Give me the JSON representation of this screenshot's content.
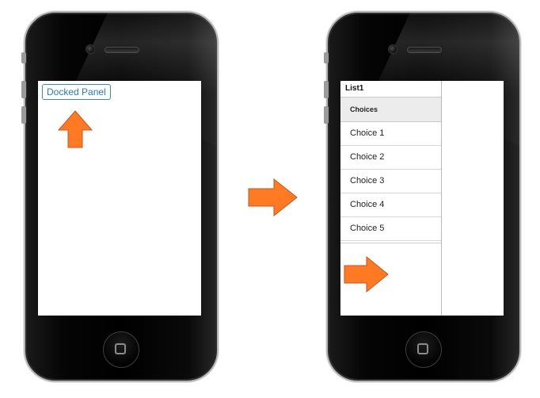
{
  "left_screen": {
    "docked_button_label": "Docked Panel"
  },
  "right_screen": {
    "panel_title": "List1",
    "list_header": "Choices",
    "items": [
      {
        "label": "Choice 1"
      },
      {
        "label": "Choice 2"
      },
      {
        "label": "Choice 3"
      },
      {
        "label": "Choice 4"
      },
      {
        "label": "Choice 5"
      }
    ]
  },
  "colors": {
    "arrow_fill": "#ff7a22",
    "arrow_stroke": "#c7541a",
    "button_text": "#2a77c9"
  },
  "icons": [
    "up-arrow-icon",
    "right-arrow-icon",
    "home-button-icon",
    "camera-icon",
    "speaker-icon"
  ]
}
